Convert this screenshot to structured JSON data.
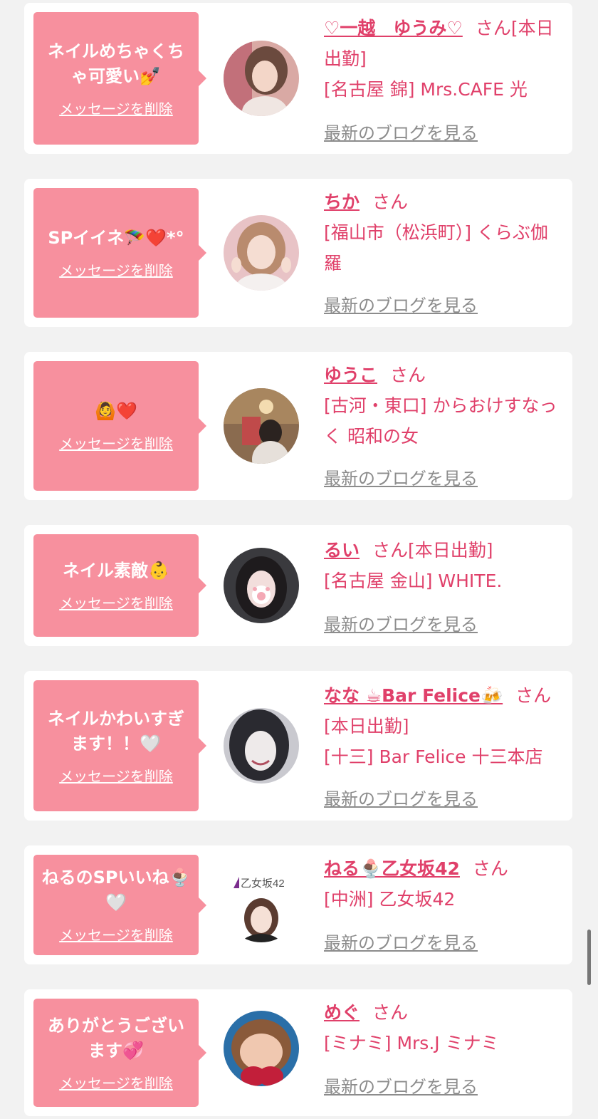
{
  "delete_label": "メッセージを削除",
  "blog_label": "最新のブログを見る",
  "san_label": "さん",
  "colors": {
    "bubble": "#f7909e",
    "accent": "#e0406a",
    "link_gray": "#8c8c8c",
    "background": "#f2f2f2"
  },
  "cards": [
    {
      "message": "ネイルめちゃくちゃ可愛い💅",
      "name": "♡一越　ゆうみ♡",
      "status": "[本日出勤]",
      "shop": "[名古屋 錦] Mrs.CAFE 光"
    },
    {
      "message": "SPイイネ🪂❤️*°",
      "name": "ちか",
      "status": "",
      "shop": "[福山市（松浜町）] くらぶ伽羅"
    },
    {
      "message": "🙆❤️",
      "name": "ゆうこ",
      "status": "",
      "shop": "[古河・東口] からおけすなっく 昭和の女"
    },
    {
      "message": "ネイル素敵👶",
      "name": "るい",
      "status": "[本日出勤]",
      "shop": "[名古屋 金山] WHITE."
    },
    {
      "message": "ネイルかわいすぎます！！🤍",
      "name": "なな ☕Bar Felice🍻",
      "status": "[本日出勤]",
      "shop": "[十三] Bar Felice 十三本店"
    },
    {
      "message": "ねるのSPいいね🍨🤍",
      "name": "ねる🍨乙女坂42",
      "status": "",
      "shop": "[中洲] 乙女坂42",
      "avatar_logo_text": "乙女坂42"
    },
    {
      "message": "ありがとうございます💞",
      "name": "めぐ",
      "status": "",
      "shop": "[ミナミ] Mrs.J ミナミ"
    }
  ]
}
